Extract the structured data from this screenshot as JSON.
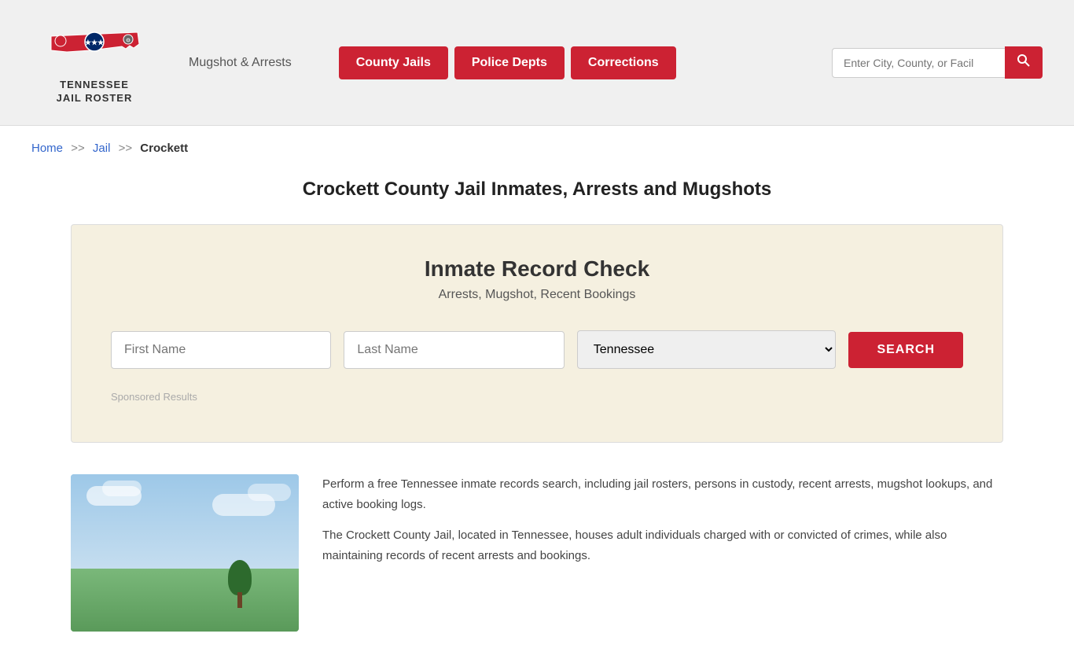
{
  "header": {
    "logo_line1": "TENNESSEE",
    "logo_line2": "JAIL ROSTER",
    "mugshot_label": "Mugshot & Arrests",
    "nav": [
      {
        "label": "County Jails",
        "id": "county-jails"
      },
      {
        "label": "Police Depts",
        "id": "police-depts"
      },
      {
        "label": "Corrections",
        "id": "corrections"
      }
    ],
    "search_placeholder": "Enter City, County, or Facil"
  },
  "breadcrumb": {
    "home": "Home",
    "sep1": ">>",
    "jail": "Jail",
    "sep2": ">>",
    "current": "Crockett"
  },
  "page": {
    "title": "Crockett County Jail Inmates, Arrests and Mugshots"
  },
  "record_check": {
    "title": "Inmate Record Check",
    "subtitle": "Arrests, Mugshot, Recent Bookings",
    "first_name_placeholder": "First Name",
    "last_name_placeholder": "Last Name",
    "state_default": "Tennessee",
    "search_btn": "SEARCH",
    "sponsored": "Sponsored Results"
  },
  "content": {
    "para1": "Perform a free Tennessee inmate records search, including jail rosters, persons in custody, recent arrests, mugshot lookups, and active booking logs.",
    "para2": "The Crockett County Jail, located in Tennessee, houses adult individuals charged with or convicted of crimes, while also maintaining records of recent arrests and bookings."
  }
}
